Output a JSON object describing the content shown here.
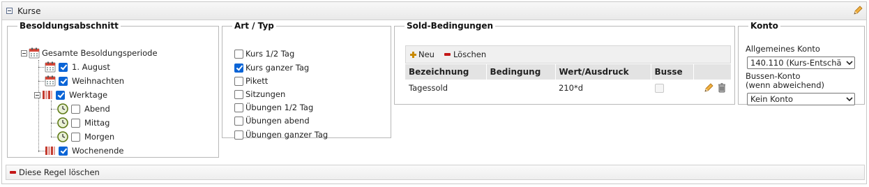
{
  "panel": {
    "title": "Kurse"
  },
  "besoldung": {
    "legend": "Besoldungsabschnitt",
    "root": "Gesamte Besoldungsperiode",
    "items": [
      {
        "label": "1. August",
        "checked": true
      },
      {
        "label": "Weihnachten",
        "checked": true
      },
      {
        "label": "Werktage",
        "checked": true
      },
      {
        "label": "Abend",
        "checked": false
      },
      {
        "label": "Mittag",
        "checked": false
      },
      {
        "label": "Morgen",
        "checked": false
      },
      {
        "label": "Wochenende",
        "checked": true
      }
    ]
  },
  "art": {
    "legend": "Art / Typ",
    "options": [
      {
        "label": "Kurs 1/2 Tag",
        "checked": false
      },
      {
        "label": "Kurs ganzer Tag",
        "checked": true
      },
      {
        "label": "Pikett",
        "checked": false
      },
      {
        "label": "Sitzungen",
        "checked": false
      },
      {
        "label": "Übungen 1/2 Tag",
        "checked": false
      },
      {
        "label": "Übungen abend",
        "checked": false
      },
      {
        "label": "Übungen ganzer Tag",
        "checked": false
      }
    ]
  },
  "sold": {
    "legend": "Sold-Bedingungen",
    "toolbar": {
      "new_label": "Neu",
      "delete_label": "Löschen"
    },
    "columns": [
      "Bezeichnung",
      "Bedingung",
      "Wert/Ausdruck",
      "Busse"
    ],
    "rows": [
      {
        "bezeichnung": "Tagessold",
        "bedingung": "",
        "wert": "210*d",
        "busse": false
      }
    ]
  },
  "konto": {
    "legend": "Konto",
    "general_label": "Allgemeines Konto",
    "general_value": "140.110 (Kurs-Entschä",
    "bussen_label_1": "Bussen-Konto",
    "bussen_label_2": "(wenn abweichend)",
    "bussen_value": "Kein Konto"
  },
  "footer": {
    "delete_rule_label": "Diese Regel löschen"
  },
  "colors": {
    "checkbox_checked": "#0a64d6",
    "delete_red": "#c41818",
    "add_orange": "#c98a00",
    "pencil": "#e8a33a"
  }
}
